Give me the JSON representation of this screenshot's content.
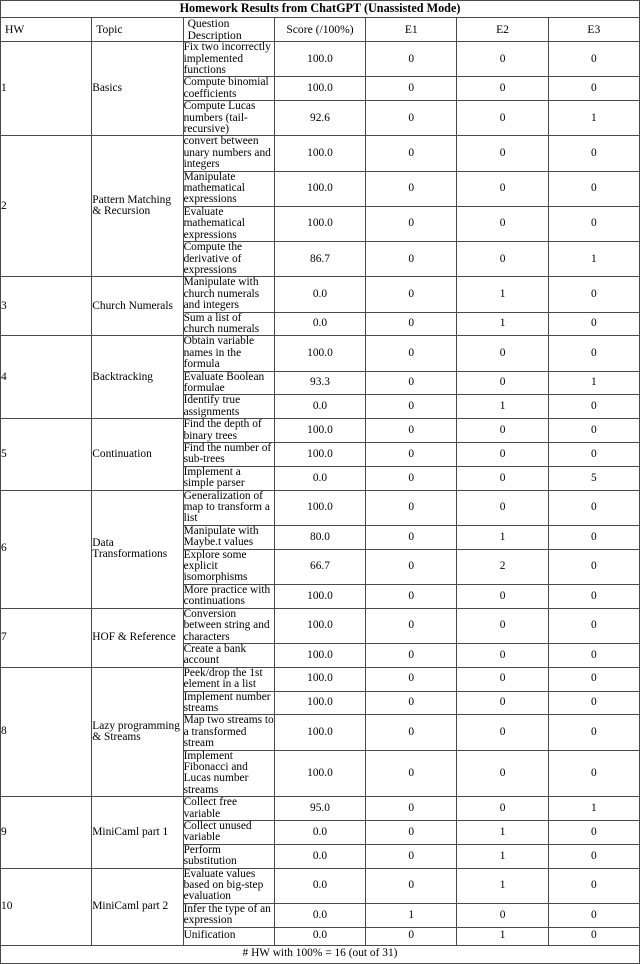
{
  "title": "Homework Results from ChatGPT (Unassisted Mode)",
  "columns": {
    "hw": "HW",
    "topic": "Topic",
    "description": "Question Description",
    "score": "Score (/100%)",
    "e1": "E1",
    "e2": "E2",
    "e3": "E3"
  },
  "groups": [
    {
      "hw": "1",
      "topic": "Basics",
      "rows": [
        {
          "description": "Fix two incorrectly implemented functions",
          "score": "100.0",
          "e1": "0",
          "e2": "0",
          "e3": "0"
        },
        {
          "description": "Compute binomial coefficients",
          "score": "100.0",
          "e1": "0",
          "e2": "0",
          "e3": "0"
        },
        {
          "description": "Compute Lucas numbers (tail-recursive)",
          "score": "92.6",
          "e1": "0",
          "e2": "0",
          "e3": "1"
        }
      ]
    },
    {
      "hw": "2",
      "topic": "Pattern Matching & Recursion",
      "rows": [
        {
          "description": "convert between unary numbers and integers",
          "score": "100.0",
          "e1": "0",
          "e2": "0",
          "e3": "0"
        },
        {
          "description": "Manipulate mathematical expressions",
          "score": "100.0",
          "e1": "0",
          "e2": "0",
          "e3": "0"
        },
        {
          "description": "Evaluate mathematical expressions",
          "score": "100.0",
          "e1": "0",
          "e2": "0",
          "e3": "0"
        },
        {
          "description": "Compute the derivative of expressions",
          "score": "86.7",
          "e1": "0",
          "e2": "0",
          "e3": "1"
        }
      ]
    },
    {
      "hw": "3",
      "topic": "Church Numerals",
      "rows": [
        {
          "description": "Manipulate with church numerals and integers",
          "score": "0.0",
          "e1": "0",
          "e2": "1",
          "e3": "0"
        },
        {
          "description": "Sum a list of church numerals",
          "score": "0.0",
          "e1": "0",
          "e2": "1",
          "e3": "0"
        }
      ]
    },
    {
      "hw": "4",
      "topic": "Backtracking",
      "rows": [
        {
          "description": "Obtain variable names in the formula",
          "score": "100.0",
          "e1": "0",
          "e2": "0",
          "e3": "0"
        },
        {
          "description": "Evaluate Boolean formulae",
          "score": "93.3",
          "e1": "0",
          "e2": "0",
          "e3": "1"
        },
        {
          "description": "Identify true assignments",
          "score": "0.0",
          "e1": "0",
          "e2": "1",
          "e3": "0"
        }
      ]
    },
    {
      "hw": "5",
      "topic": "Continuation",
      "rows": [
        {
          "description": "Find the depth of binary trees",
          "score": "100.0",
          "e1": "0",
          "e2": "0",
          "e3": "0"
        },
        {
          "description": "Find the number of sub-trees",
          "score": "100.0",
          "e1": "0",
          "e2": "0",
          "e3": "0"
        },
        {
          "description": "Implement a simple parser",
          "score": "0.0",
          "e1": "0",
          "e2": "0",
          "e3": "5"
        }
      ]
    },
    {
      "hw": "6",
      "topic": "Data Transformations",
      "rows": [
        {
          "description": "Generalization of map to transform a list",
          "score": "100.0",
          "e1": "0",
          "e2": "0",
          "e3": "0"
        },
        {
          "description": "Manipulate with Maybe.t values",
          "score": "80.0",
          "e1": "0",
          "e2": "1",
          "e3": "0"
        },
        {
          "description": "Explore some explicit isomorphisms",
          "score": "66.7",
          "e1": "0",
          "e2": "2",
          "e3": "0"
        },
        {
          "description": "More practice with continuations",
          "score": "100.0",
          "e1": "0",
          "e2": "0",
          "e3": "0"
        }
      ]
    },
    {
      "hw": "7",
      "topic": "HOF & Reference",
      "rows": [
        {
          "description": "Conversion between string and characters",
          "score": "100.0",
          "e1": "0",
          "e2": "0",
          "e3": "0"
        },
        {
          "description": "Create a bank account",
          "score": "100.0",
          "e1": "0",
          "e2": "0",
          "e3": "0"
        }
      ]
    },
    {
      "hw": "8",
      "topic": "Lazy programming & Streams",
      "rows": [
        {
          "description": "Peek/drop the 1st element in a list",
          "score": "100.0",
          "e1": "0",
          "e2": "0",
          "e3": "0"
        },
        {
          "description": "Implement number streams",
          "score": "100.0",
          "e1": "0",
          "e2": "0",
          "e3": "0"
        },
        {
          "description": "Map two streams to a transformed stream",
          "score": "100.0",
          "e1": "0",
          "e2": "0",
          "e3": "0"
        },
        {
          "description": "Implement Fibonacci and Lucas number streams",
          "score": "100.0",
          "e1": "0",
          "e2": "0",
          "e3": "0"
        }
      ]
    },
    {
      "hw": "9",
      "topic": "MiniCaml part 1",
      "rows": [
        {
          "description": "Collect free variable",
          "score": "95.0",
          "e1": "0",
          "e2": "0",
          "e3": "1"
        },
        {
          "description": "Collect unused variable",
          "score": "0.0",
          "e1": "0",
          "e2": "1",
          "e3": "0"
        },
        {
          "description": "Perform substitution",
          "score": "0.0",
          "e1": "0",
          "e2": "1",
          "e3": "0"
        }
      ]
    },
    {
      "hw": "10",
      "topic": "MiniCaml part 2",
      "rows": [
        {
          "description": "Evaluate values based on big-step evaluation",
          "score": "0.0",
          "e1": "0",
          "e2": "1",
          "e3": "0"
        },
        {
          "description": "Infer the type of an expression",
          "score": "0.0",
          "e1": "1",
          "e2": "0",
          "e3": "0"
        },
        {
          "description": "Unification",
          "score": "0.0",
          "e1": "0",
          "e2": "1",
          "e3": "0"
        }
      ]
    }
  ],
  "footer": "# HW with 100% = 16 (out of 31)"
}
